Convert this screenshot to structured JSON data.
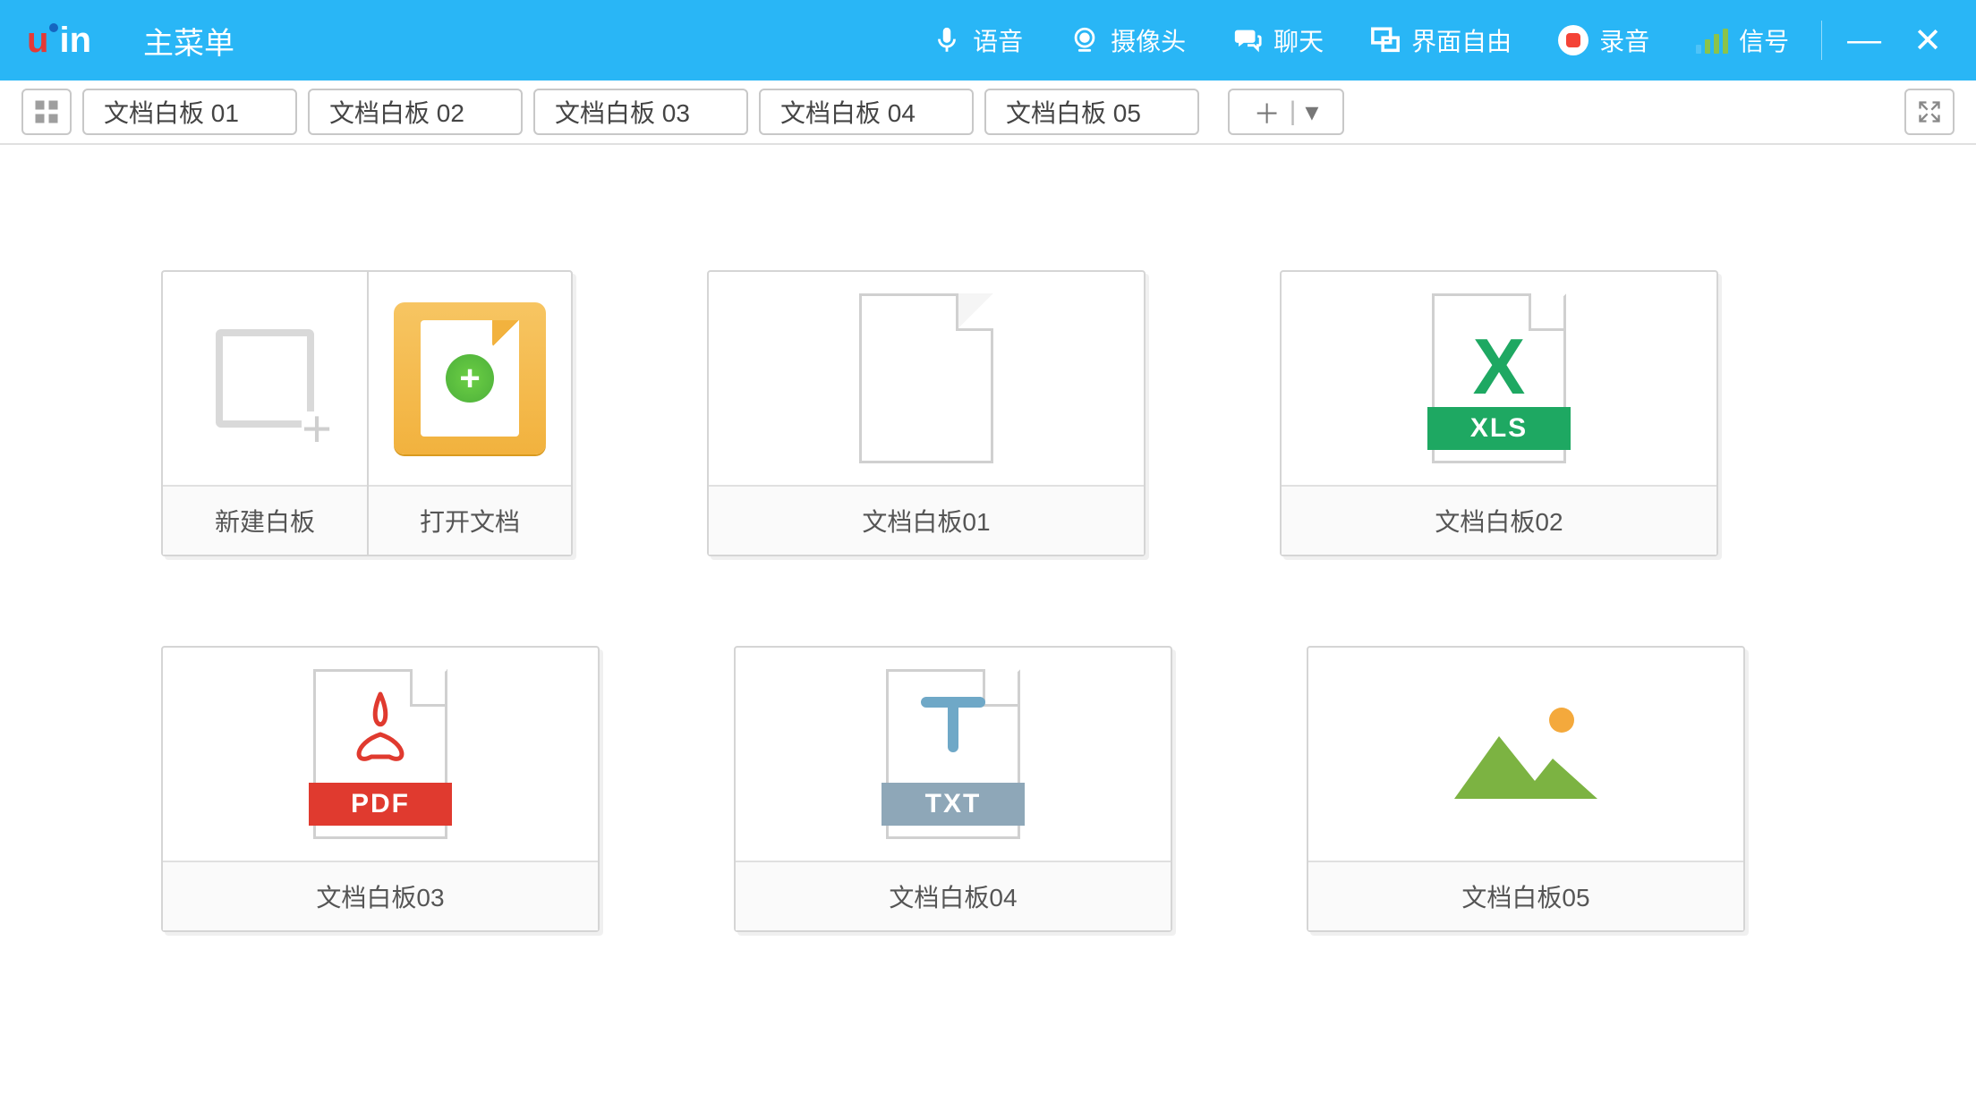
{
  "header": {
    "logo_text": "uin",
    "title": "主菜单",
    "items": [
      {
        "id": "voice",
        "label": "语音"
      },
      {
        "id": "camera",
        "label": "摄像头"
      },
      {
        "id": "chat",
        "label": "聊天"
      },
      {
        "id": "layout",
        "label": "界面自由"
      },
      {
        "id": "record",
        "label": "录音"
      },
      {
        "id": "signal",
        "label": "信号"
      }
    ]
  },
  "tabs": [
    "文档白板 01",
    "文档白板 02",
    "文档白板 03",
    "文档白板 04",
    "文档白板 05"
  ],
  "actions": {
    "new_board": "新建白板",
    "open_doc": "打开文档"
  },
  "cards": [
    {
      "label": "文档白板01",
      "type": "blank"
    },
    {
      "label": "文档白板02",
      "type": "xls",
      "badge": "XLS"
    },
    {
      "label": "文档白板03",
      "type": "pdf",
      "badge": "PDF"
    },
    {
      "label": "文档白板04",
      "type": "txt",
      "badge": "TXT"
    },
    {
      "label": "文档白板05",
      "type": "image"
    }
  ],
  "colors": {
    "topbar": "#29b6f6",
    "xls": "#1ea862",
    "pdf": "#e03a2f",
    "txt": "#8ea7b8",
    "open_doc_bg": "#f2b23e"
  }
}
